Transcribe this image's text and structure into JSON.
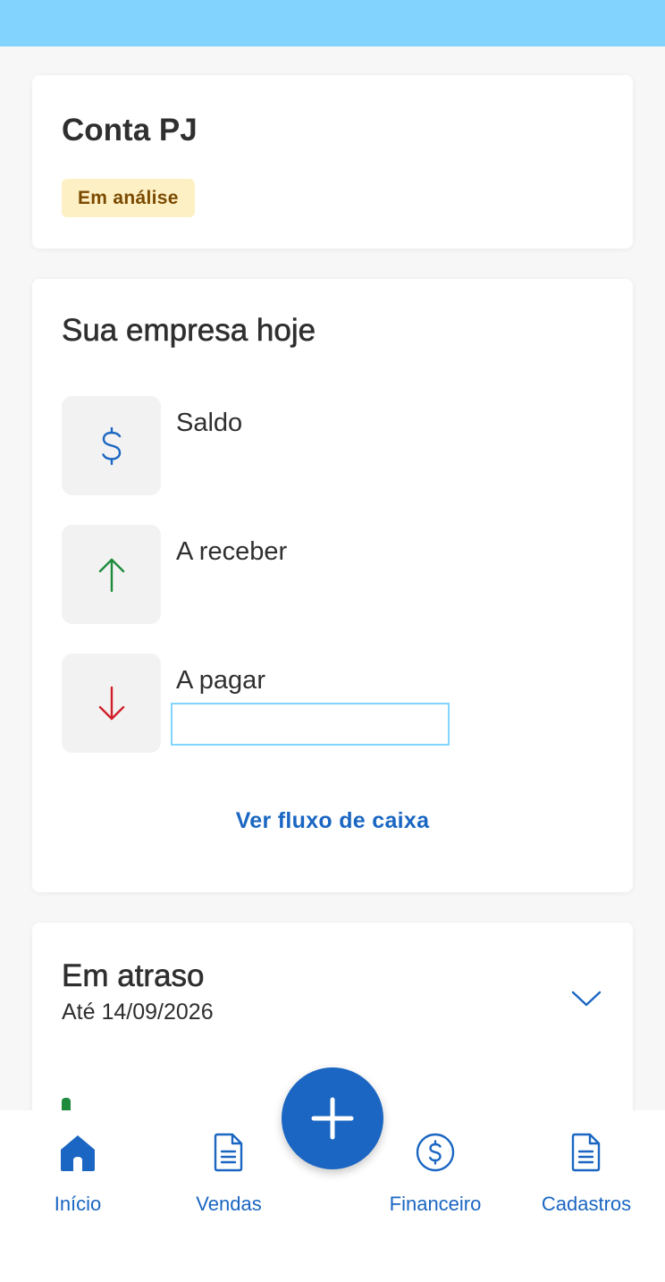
{
  "account": {
    "title": "Conta PJ",
    "status_badge": "Em análise"
  },
  "today": {
    "title": "Sua empresa hoje",
    "rows": [
      {
        "label": "Saldo",
        "icon": "dollar-icon",
        "color": "#1a66c2"
      },
      {
        "label": "A receber",
        "icon": "arrow-up-icon",
        "color": "#1e8a3c"
      },
      {
        "label": "A pagar",
        "icon": "arrow-down-icon",
        "color": "#d11f2a"
      }
    ],
    "link": "Ver fluxo de caixa"
  },
  "overdue": {
    "title": "Em atraso",
    "subtitle": "Até 14/09/2026",
    "icon": "chevron-down-icon"
  },
  "fab": {
    "icon": "plus-icon"
  },
  "nav": {
    "items": [
      {
        "label": "Início",
        "icon": "home-icon"
      },
      {
        "label": "Vendas",
        "icon": "document-icon"
      },
      {
        "label": "Financeiro",
        "icon": "dollar-circle-icon"
      },
      {
        "label": "Cadastros",
        "icon": "document-icon"
      }
    ]
  },
  "colors": {
    "primary": "#1a66c2",
    "status_bar": "#82d4ff",
    "badge_bg": "#fdf0c4",
    "badge_text": "#7a4a00"
  }
}
